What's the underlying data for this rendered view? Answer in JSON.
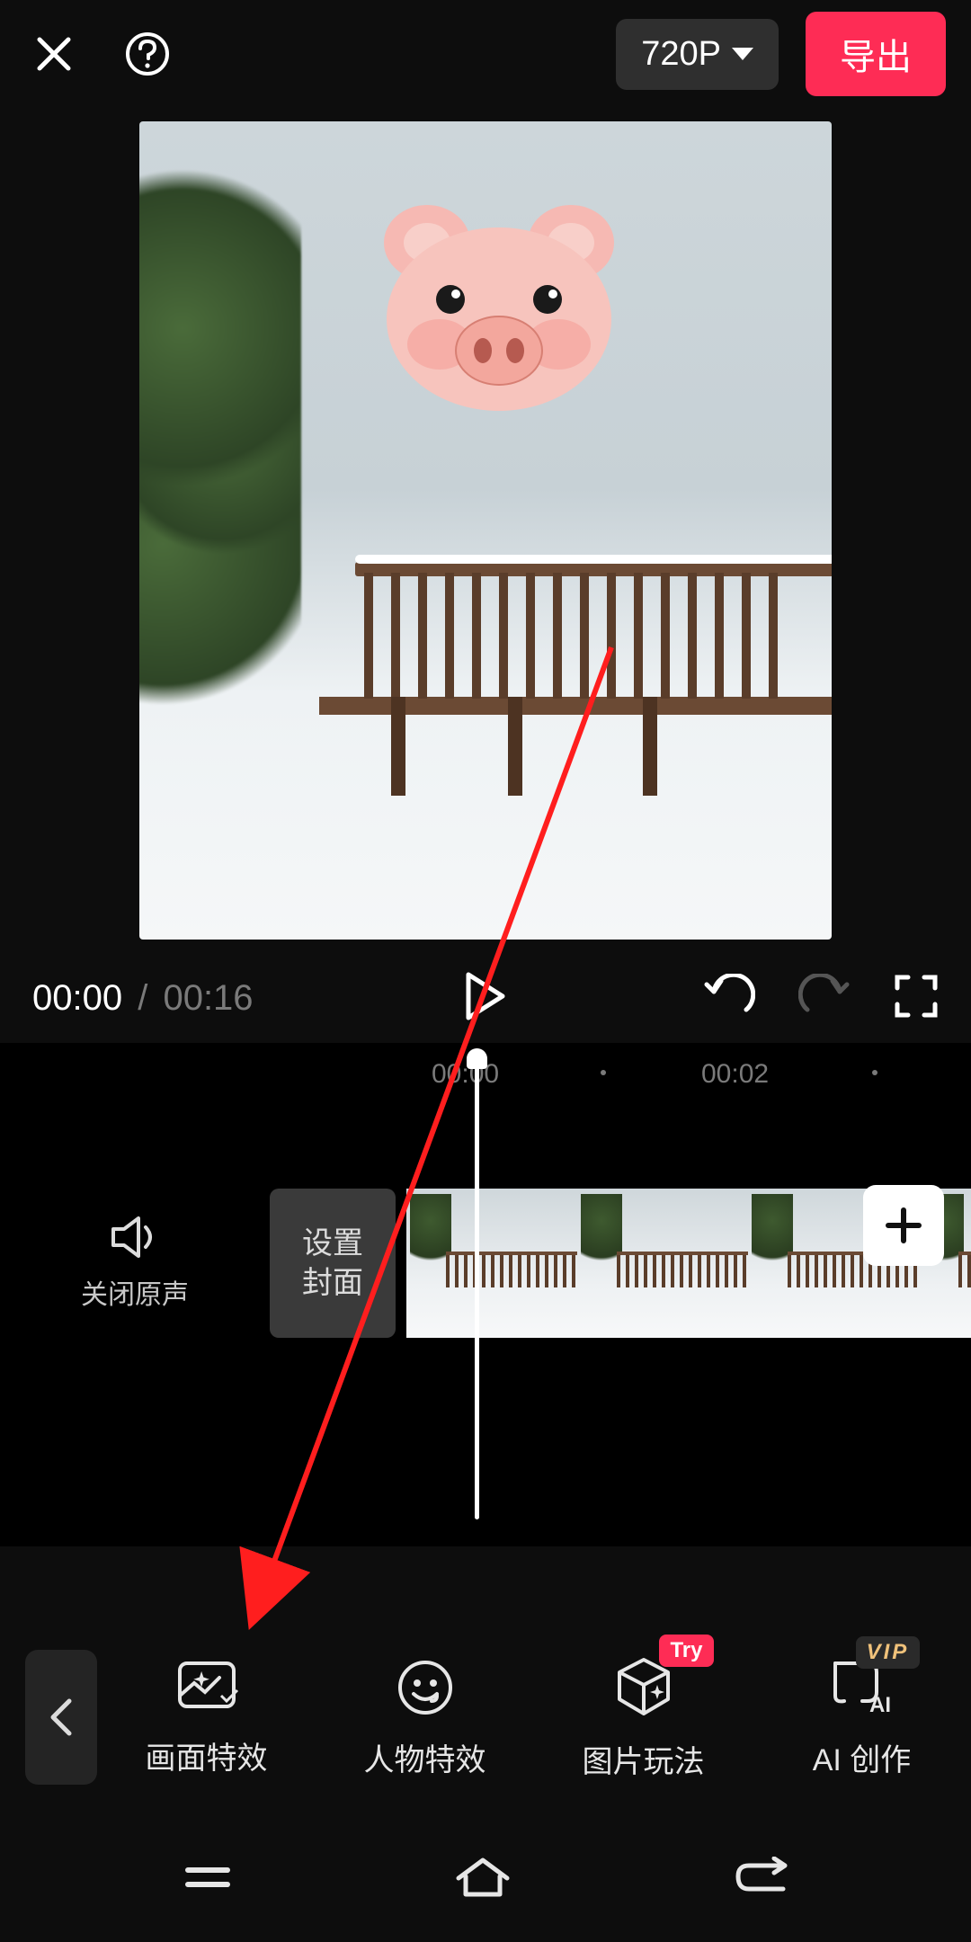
{
  "header": {
    "resolution_label": "720P",
    "export_label": "导出"
  },
  "transport": {
    "current_time": "00:00",
    "total_time": "00:16"
  },
  "timeline": {
    "ruler_marks": [
      "00:00",
      "00:02"
    ],
    "mute_label": "关闭原声",
    "cover_line1": "设置",
    "cover_line2": "封面"
  },
  "tools": {
    "items": [
      {
        "label": "画面特效",
        "badge": ""
      },
      {
        "label": "人物特效",
        "badge": ""
      },
      {
        "label": "图片玩法",
        "badge": "Try"
      },
      {
        "label": "AI 创作",
        "badge": "VIP"
      }
    ]
  },
  "colors": {
    "accent": "#fe2c55",
    "bg": "#0d0d0d"
  }
}
